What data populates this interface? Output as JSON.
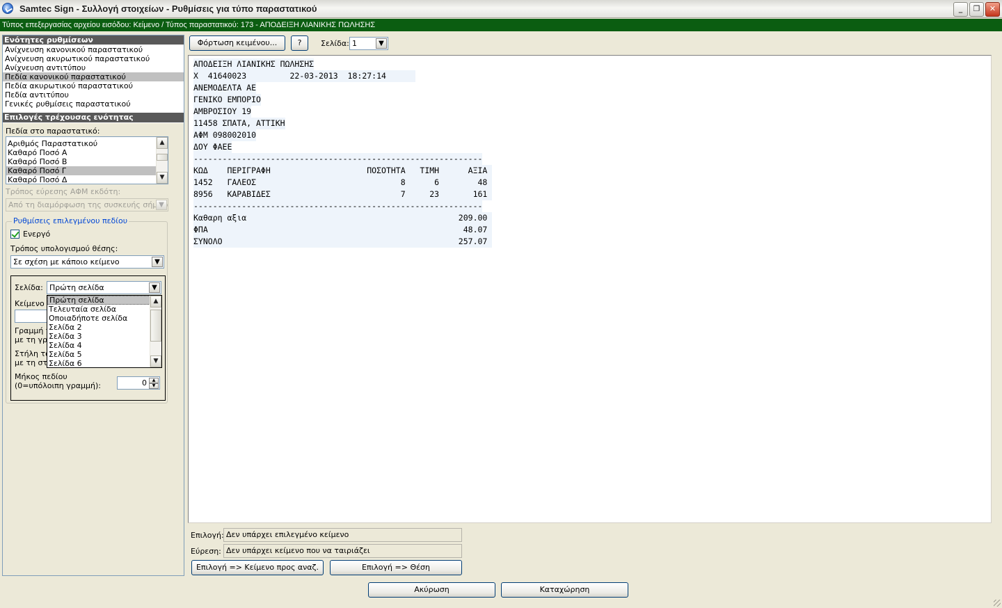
{
  "window": {
    "title": "Samtec Sign - Συλλογή στοιχείων - Ρυθμίσεις για τύπο παραστατικού",
    "minimize": "_",
    "maximize": "❐",
    "close": "✕"
  },
  "status_line": "Τύπος επεξεργασίας αρχείου εισόδου: Κείμενο / Τύπος παραστατικού: 173 - ΑΠΟΔΕΙΞΗ ΛΙΑΝΙΚΗΣ ΠΩΛΗΣΗΣ",
  "sections": {
    "header": "Ενότητες ρυθμίσεων",
    "items": [
      {
        "label": "Ανίχνευση κανονικού παραστατικού",
        "selected": false
      },
      {
        "label": "Ανίχνευση ακυρωτικού παραστατικού",
        "selected": false
      },
      {
        "label": "Ανίχνευση αντιτύπου",
        "selected": false
      },
      {
        "label": "Πεδία κανονικού παραστατικού",
        "selected": true
      },
      {
        "label": "Πεδία ακυρωτικού παραστατικού",
        "selected": false
      },
      {
        "label": "Πεδία αντιτύπου",
        "selected": false
      },
      {
        "label": "Γενικές ρυθμίσεις παραστατικού",
        "selected": false
      }
    ]
  },
  "options": {
    "header": "Επιλογές τρέχουσας ενότητας",
    "fields_label": "Πεδία στο παραστατικό:",
    "fields": [
      {
        "label": "Αριθμός Παραστατικού",
        "selected": false
      },
      {
        "label": "Καθαρό Ποσό Α",
        "selected": false
      },
      {
        "label": "Καθαρό Ποσό Β",
        "selected": false
      },
      {
        "label": "Καθαρό Ποσό Γ",
        "selected": true
      },
      {
        "label": "Καθαρό Ποσό Δ",
        "selected": false
      }
    ],
    "afm_label": "Τρόπος εύρεσης ΑΦΜ εκδότη:",
    "afm_value": "Από τη διαμόρφωση της συσκευής σήμανσης",
    "group_title": "Ρυθμίσεις επιλεγμένου πεδίου",
    "active_label": "Ενεργό",
    "active_checked": true,
    "position_method_label": "Τρόπος υπολογισμού θέσης:",
    "position_method_value": "Σε σχέση με κάποιο κείμενο",
    "page_label": "Σελίδα:",
    "page_value": "Πρώτη σελίδα",
    "text_label_partial": "Κείμενο π",
    "line_label_1": "Γραμμή τ",
    "line_label_2": "με τη γρα",
    "column_label_1": "Στήλη του",
    "column_label_2": "με τη στή",
    "length_label_1": "Μήκος πεδίου",
    "length_label_2": "(0=υπόλοιπη γραμμή):",
    "length_value": "0",
    "page_options": [
      {
        "label": "Πρώτη σελίδα",
        "highlighted": true
      },
      {
        "label": "Τελευταία σελίδα",
        "highlighted": false
      },
      {
        "label": "Οποιαδήποτε σελίδα",
        "highlighted": false
      },
      {
        "label": "Σελίδα 2",
        "highlighted": false
      },
      {
        "label": "Σελίδα 3",
        "highlighted": false
      },
      {
        "label": "Σελίδα 4",
        "highlighted": false
      },
      {
        "label": "Σελίδα 5",
        "highlighted": false
      },
      {
        "label": "Σελίδα 6",
        "highlighted": false
      }
    ]
  },
  "toolbar": {
    "load_text_label": "Φόρτωση κειμένου...",
    "help_label": "?",
    "page_label": "Σελίδα:",
    "page_value": "1"
  },
  "document": {
    "lines": [
      "ΑΠΟΔΕΙΞΗ ΛΙΑΝΙΚΗΣ ΠΩΛΗΣΗΣ",
      "Χ  41640023         22-03-2013  18:27:14      ",
      "ΑΝΕΜΟΔΕΛΤΑ ΑΕ",
      "ΓΕΝΙΚΟ ΕΜΠΟΡΙΟ",
      "ΑΜΒΡΟΣΙΟΥ 19",
      "11458 ΣΠΑΤΑ, ΑΤΤΙΚΗ",
      "ΑΦΜ 098002010",
      "ΔΟΥ ΦΑΕΕ",
      "------------------------------------------------------------",
      "ΚΩΔ    ΠΕΡΙΓΡΑΦΗ                    ΠΟΣΟΤΗΤΑ   ΤΙΜΗ      ΑΞΙΑ ",
      "1452   ΓΑΛΕΟΣ                              8      6        48 ",
      "8956   ΚΑΡΑΒΙΔΕΣ                           7     23       161 ",
      "------------------------------------------------------------",
      "Καθαρη αξια                                            209.00 ",
      "ΦΠΑ                                                     48.07 ",
      "ΣΥΝΟΛΟ                                                 257.07 "
    ]
  },
  "selection": {
    "label": "Επιλογή:",
    "value": "Δεν υπάρχει επιλεγμένο κείμενο"
  },
  "search": {
    "label": "Εύρεση:",
    "value": "Δεν υπάρχει κείμενο που να ταιριάζει"
  },
  "actions": {
    "select_to_search_text": "Επιλογή => Κείμενο προς αναζ.",
    "select_to_position": "Επιλογή => Θέση",
    "cancel": "Ακύρωση",
    "save": "Καταχώρηση"
  },
  "icons": {
    "app": "samtec-app-icon",
    "dropdown": "chevron-down-icon",
    "scroll_up": "arrow-up-icon",
    "scroll_down": "arrow-down-icon"
  },
  "colors": {
    "status_bar": "#0b5d11",
    "section_header": "#595959",
    "selected_row": "#c0c0c0",
    "group_title": "#0046d5",
    "doc_highlight": "#eef4fb"
  }
}
